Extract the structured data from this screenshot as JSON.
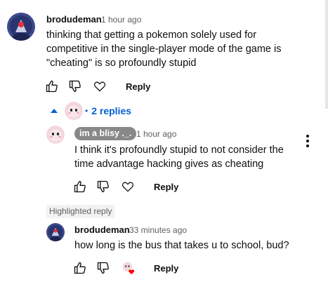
{
  "comment": {
    "author": "brodudeman",
    "time": "1 hour ago",
    "lines": [
      "thinking that getting a pokemon solely used for",
      "competitive in the single-player mode of the game is",
      "\"cheating\" is so profoundly stupid"
    ],
    "reply_label": "Reply"
  },
  "replies_toggle": {
    "label": "2 replies",
    "separator": "•"
  },
  "reply1": {
    "author": "im a blisy ._.",
    "time": "1 hour ago",
    "lines": [
      "I think it's profoundly stupid to not consider the",
      "time advantage hacking gives as cheating"
    ],
    "reply_label": "Reply"
  },
  "reply2": {
    "badge": "Highlighted reply",
    "author": "brodudeman",
    "time": "33 minutes ago",
    "lines": [
      "how long is the bus that takes u to school, bud?"
    ],
    "reply_label": "Reply"
  },
  "icons": {
    "like": "thumbs-up-icon",
    "dislike": "thumbs-down-icon",
    "heart": "heart-icon",
    "creator_heart": "creator-heart-icon",
    "more": "more-vert-icon",
    "collapse": "caret-up-icon"
  },
  "colors": {
    "link_blue": "#065fd4",
    "chip_grey": "#888888",
    "heart_red": "#ff0000",
    "muted_text": "#606060"
  }
}
